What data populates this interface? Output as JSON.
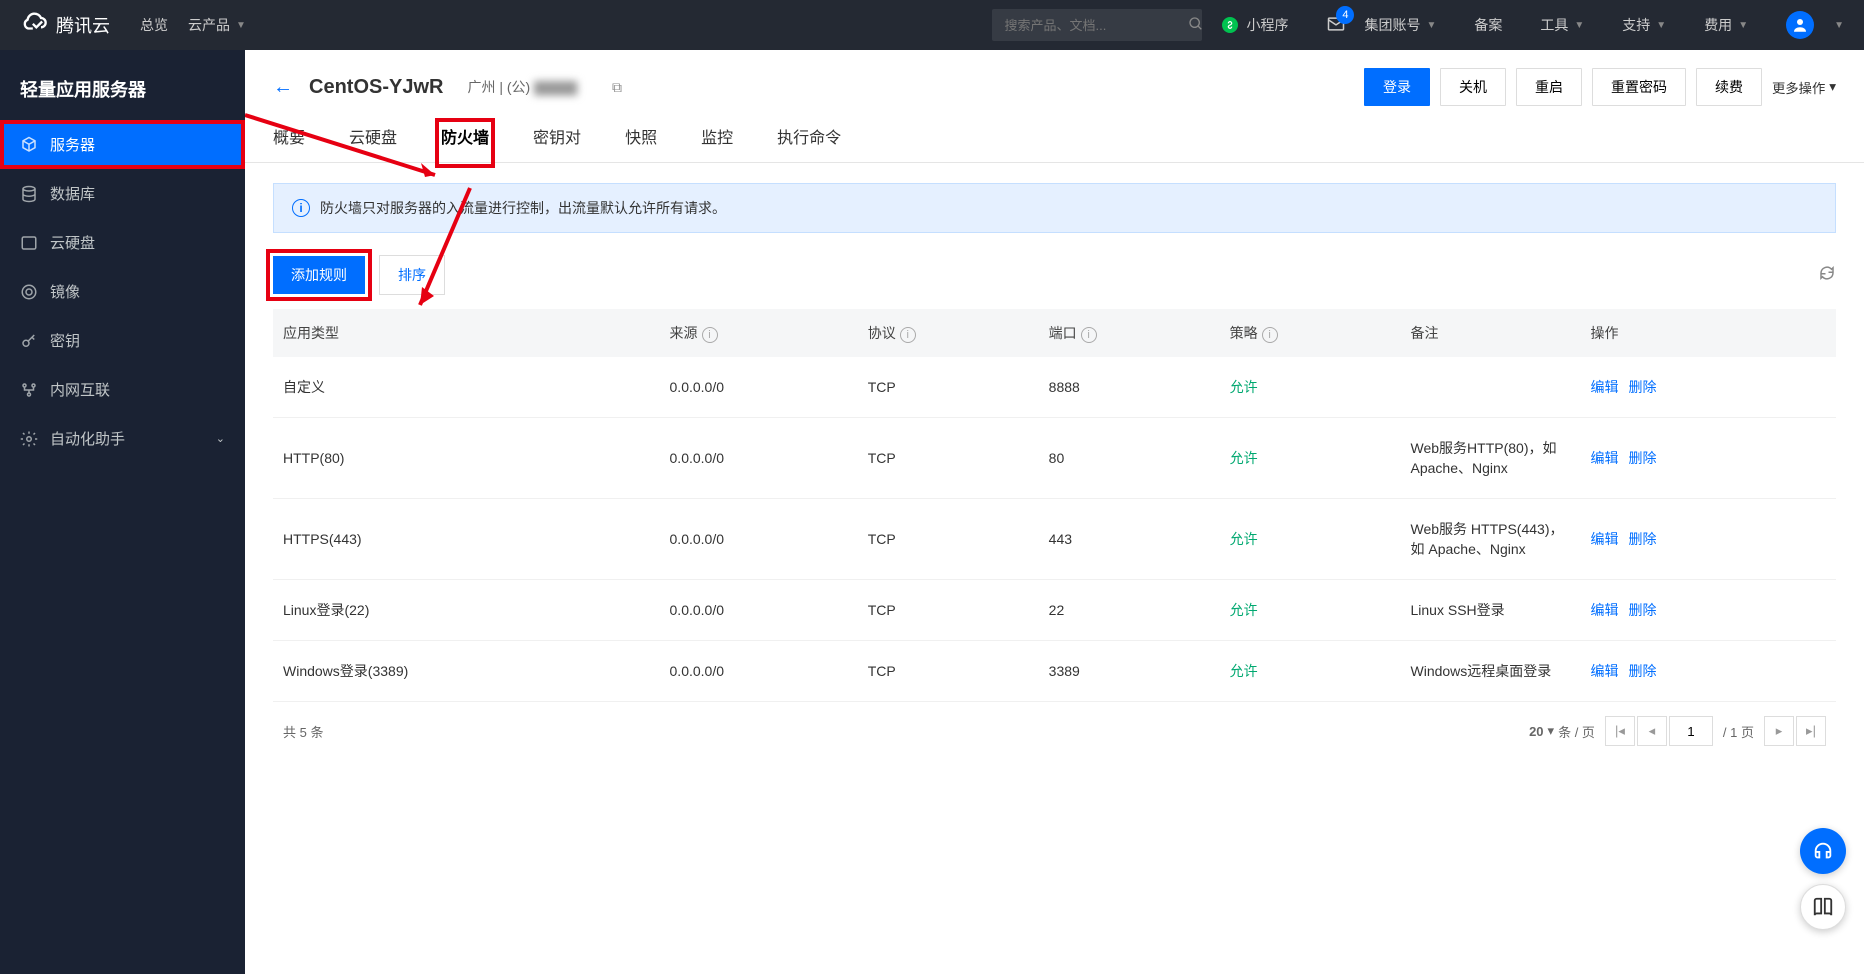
{
  "header": {
    "brand": "腾讯云",
    "nav": {
      "overview": "总览",
      "products": "云产品"
    },
    "search_placeholder": "搜索产品、文档...",
    "miniprogram": "小程序",
    "mail_count": "4",
    "account": "集团账号",
    "beian": "备案",
    "tools": "工具",
    "support": "支持",
    "cost": "费用"
  },
  "sidebar": {
    "title": "轻量应用服务器",
    "items": [
      {
        "label": "服务器"
      },
      {
        "label": "数据库"
      },
      {
        "label": "云硬盘"
      },
      {
        "label": "镜像"
      },
      {
        "label": "密钥"
      },
      {
        "label": "内网互联"
      },
      {
        "label": "自动化助手"
      }
    ]
  },
  "page": {
    "instance_name": "CentOS-YJwR",
    "region": "广州 | (公)",
    "actions": {
      "login": "登录",
      "shutdown": "关机",
      "restart": "重启",
      "reset_pwd": "重置密码",
      "renew": "续费",
      "more": "更多操作"
    }
  },
  "tabs": [
    "概要",
    "云硬盘",
    "防火墙",
    "密钥对",
    "快照",
    "监控",
    "执行命令"
  ],
  "banner": "防火墙只对服务器的入流量进行控制，出流量默认允许所有请求。",
  "toolbar": {
    "add": "添加规则",
    "sort": "排序"
  },
  "table": {
    "headers": {
      "type": "应用类型",
      "source": "来源",
      "protocol": "协议",
      "port": "端口",
      "policy": "策略",
      "remark": "备注",
      "action": "操作"
    },
    "action_labels": {
      "edit": "编辑",
      "delete": "删除"
    },
    "rows": [
      {
        "type": "自定义",
        "source": "0.0.0.0/0",
        "protocol": "TCP",
        "port": "8888",
        "policy": "允许",
        "remark": ""
      },
      {
        "type": "HTTP(80)",
        "source": "0.0.0.0/0",
        "protocol": "TCP",
        "port": "80",
        "policy": "允许",
        "remark": "Web服务HTTP(80)，如 Apache、Nginx"
      },
      {
        "type": "HTTPS(443)",
        "source": "0.0.0.0/0",
        "protocol": "TCP",
        "port": "443",
        "policy": "允许",
        "remark": "Web服务 HTTPS(443)，如 Apache、Nginx"
      },
      {
        "type": "Linux登录(22)",
        "source": "0.0.0.0/0",
        "protocol": "TCP",
        "port": "22",
        "policy": "允许",
        "remark": "Linux SSH登录"
      },
      {
        "type": "Windows登录(3389)",
        "source": "0.0.0.0/0",
        "protocol": "TCP",
        "port": "3389",
        "policy": "允许",
        "remark": "Windows远程桌面登录"
      }
    ]
  },
  "pagination": {
    "total_text": "共 5 条",
    "page_size": "20",
    "per_page_label": "条 / 页",
    "current": "1",
    "total_pages": "/ 1 页"
  }
}
